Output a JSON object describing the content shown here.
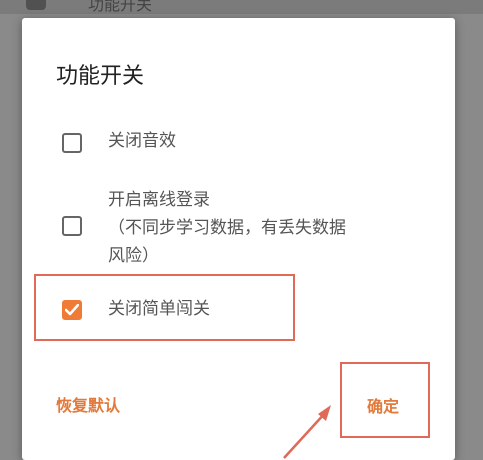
{
  "background": {
    "title": "功能开关",
    "icon": "gear-icon"
  },
  "dialog": {
    "title": "功能开关",
    "options": [
      {
        "label": "关闭音效",
        "checked": false
      },
      {
        "label_line1": "开启离线登录",
        "label_line2": "（不同步学习数据，有丢失数据",
        "label_line3": "风险）",
        "checked": false
      },
      {
        "label": "关闭简单闯关",
        "checked": true
      }
    ],
    "reset_label": "恢复默认",
    "confirm_label": "确定"
  },
  "colors": {
    "accent": "#f07b36",
    "highlight": "#e06a57",
    "action_text": "#e37a3b"
  }
}
